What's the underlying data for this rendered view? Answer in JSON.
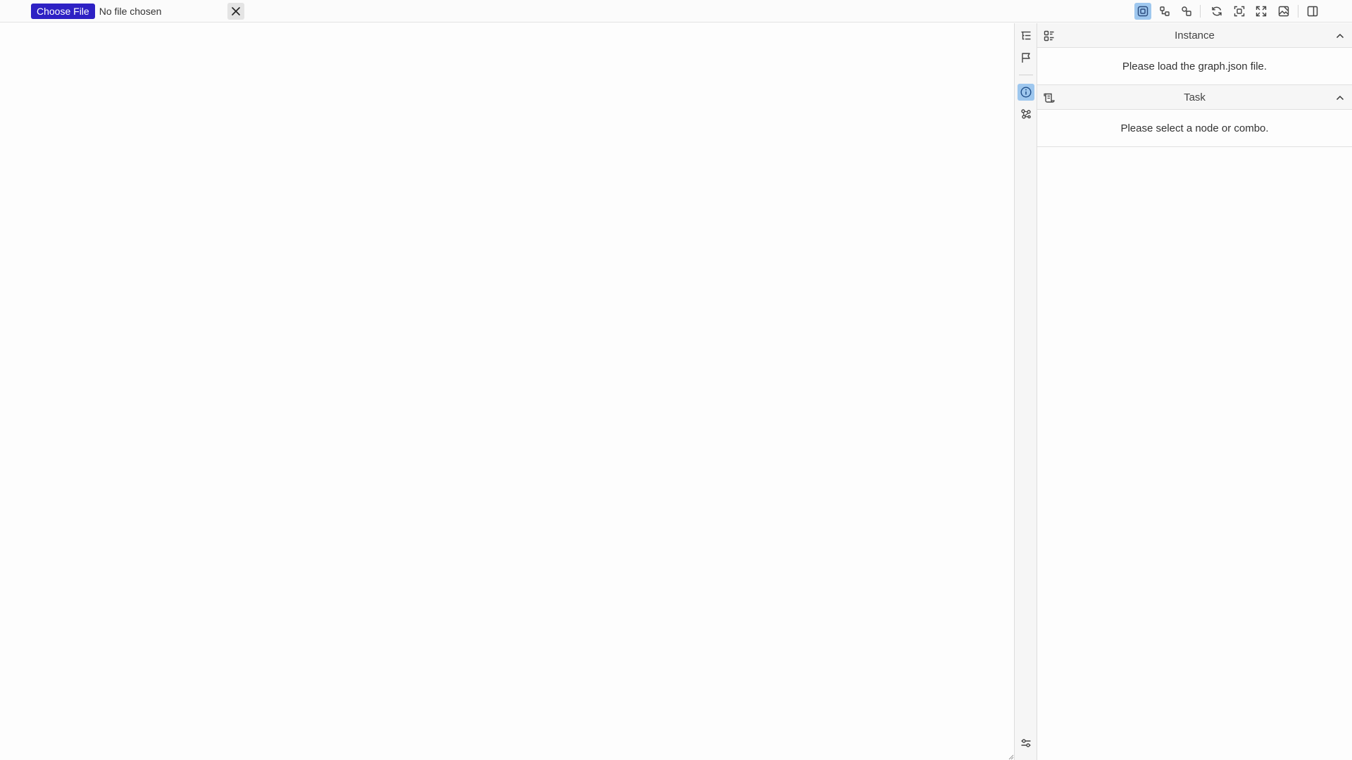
{
  "file_input": {
    "button_label": "Choose File",
    "status": "No file chosen"
  },
  "toolbar": {
    "icons": [
      "node-mode-icon",
      "layout-icon",
      "combo-icon",
      "refresh-icon",
      "fit-view-icon",
      "fullscreen-icon",
      "export-image-icon",
      "toggle-panel-icon"
    ],
    "active_icon": "node-mode-icon",
    "accent_color": "#9ec7ee"
  },
  "rail": {
    "icons": [
      "outline-icon",
      "flag-icon",
      "info-icon",
      "graph-icon",
      "settings-sliders-icon"
    ],
    "active_icon": "info-icon"
  },
  "panel": {
    "instance": {
      "title": "Instance",
      "message": "Please load the graph.json file."
    },
    "task": {
      "title": "Task",
      "message": "Please select a node or combo."
    }
  },
  "colors": {
    "primary_button": "#2e21c4",
    "active_highlight": "#9ec7ee",
    "background": "#fdfdfd"
  }
}
